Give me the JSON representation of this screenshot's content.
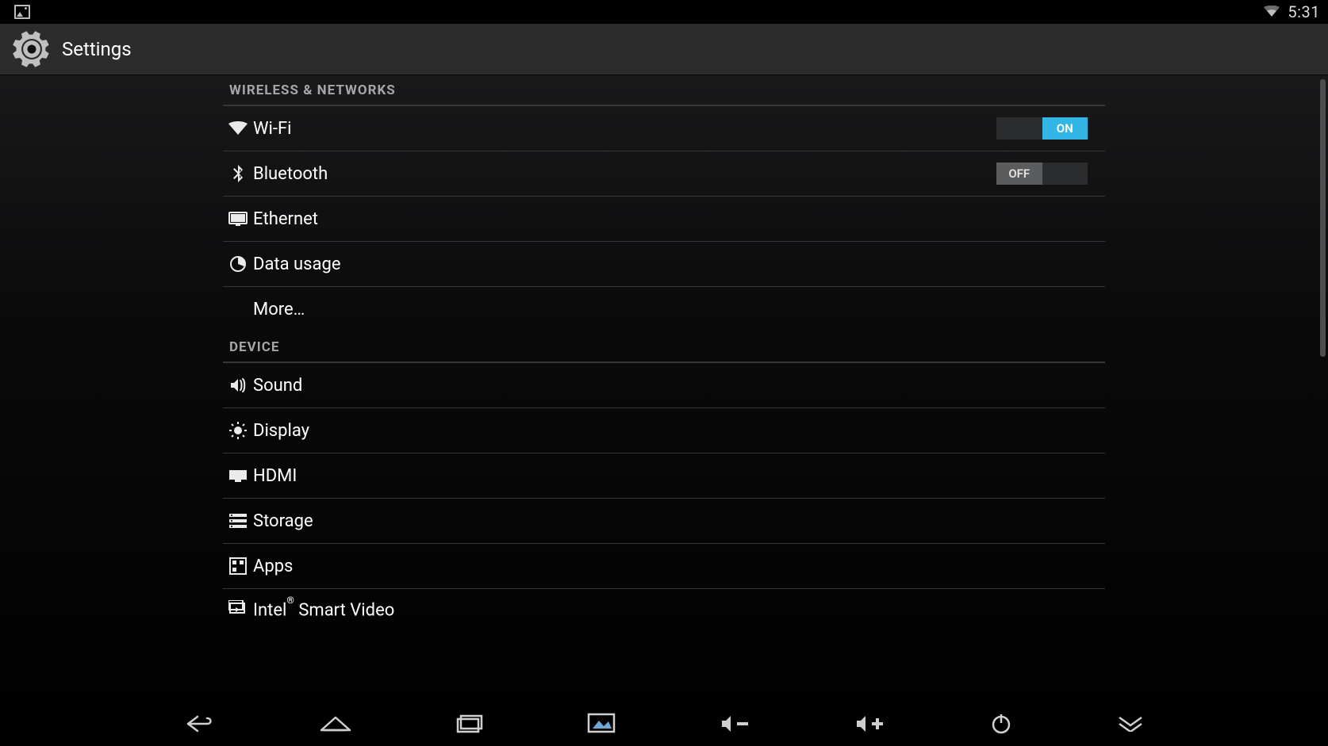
{
  "status_bar": {
    "clock": "5:31"
  },
  "action_bar": {
    "title": "Settings"
  },
  "sections": {
    "wireless_header": "WIRELESS & NETWORKS",
    "device_header": "DEVICE"
  },
  "items": {
    "wifi": {
      "label": "Wi-Fi",
      "switch_state": "on",
      "switch_label": "ON"
    },
    "bluetooth": {
      "label": "Bluetooth",
      "switch_state": "off",
      "switch_label": "OFF"
    },
    "ethernet": {
      "label": "Ethernet"
    },
    "data_usage": {
      "label": "Data usage"
    },
    "more": {
      "label": "More…"
    },
    "sound": {
      "label": "Sound"
    },
    "display": {
      "label": "Display"
    },
    "hdmi": {
      "label": "HDMI"
    },
    "storage": {
      "label": "Storage"
    },
    "apps": {
      "label": "Apps"
    },
    "intel_smart_video": {
      "label_html": "Intel<sup>®</sup> Smart Video",
      "label_plain": "Intel® Smart Video"
    }
  },
  "colors": {
    "holo_blue": "#33b5e5"
  }
}
